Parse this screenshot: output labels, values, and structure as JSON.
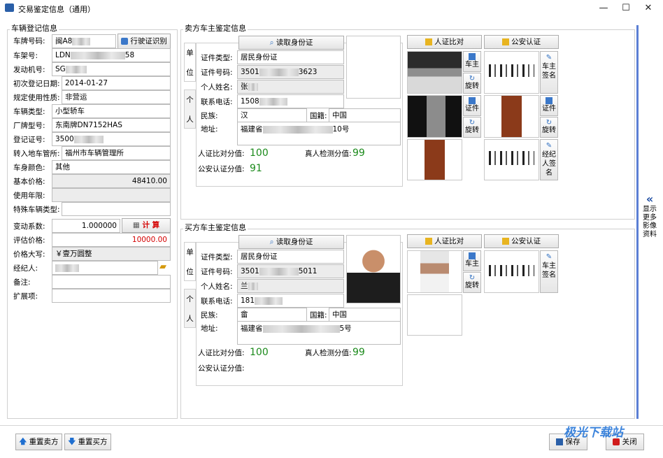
{
  "window": {
    "title": "交易鉴定信息（通用）",
    "minimize": "—",
    "maximize": "☐",
    "close": "✕"
  },
  "vehicle": {
    "section_title": "车辆登记信息",
    "plate_label": "车牌号码:",
    "plate_value": "闽A8",
    "ocr_button": "行驶证识别",
    "vin_label": "车架号:",
    "vin_value_start": "LDN",
    "vin_value_end": "58",
    "engine_label": "发动机号:",
    "engine_value": "SG",
    "first_reg_label": "初次登记日期:",
    "first_reg_value": "2014-01-27",
    "usage_label": "规定使用性质:",
    "usage_value": "非营运",
    "type_label": "车辆类型:",
    "type_value": "小型轿车",
    "model_label": "厂牌型号:",
    "model_value": "东南牌DN7152HAS",
    "cert_label": "登记证号:",
    "cert_value": "3500",
    "transfer_label": "转入地车管所:",
    "transfer_value": "福州市车辆管理所",
    "color_label": "车身颜色:",
    "color_value": "其他",
    "base_price_label": "基本价格:",
    "base_price_value": "48410.00",
    "years_label": "使用年限:",
    "years_value": "",
    "special_label": "特殊车辆类型:",
    "special_value": "",
    "coef_label": "变动系数:",
    "coef_value": "1.000000",
    "calc_button": "计 算",
    "eval_label": "评估价格:",
    "eval_value": "10000.00",
    "upper_label": "价格大写:",
    "upper_value": "￥壹万圆整",
    "broker_label": "经纪人:",
    "broker_value": "",
    "note_label": "备注:",
    "note_value": "",
    "ext_label": "扩展项:",
    "ext_value": ""
  },
  "seller": {
    "section_title": "卖方车主鉴定信息",
    "tab_chars": [
      "单",
      "位",
      "个",
      "人"
    ],
    "read_id_button": "读取身份证",
    "id_type_label": "证件类型:",
    "id_type_value": "居民身份证",
    "id_no_label": "证件号码:",
    "id_no_start": "3501",
    "id_no_end": "3623",
    "name_label": "个人姓名:",
    "name_value": "张",
    "phone_label": "联系电话:",
    "phone_value": "1508",
    "nation_label": "民族:",
    "nation_value": "汉",
    "country_label": "国籍:",
    "country_value": "中国",
    "addr_label": "地址:",
    "addr_start": "福建省",
    "addr_end": "10号",
    "match_label": "人证比对分值:",
    "match_value": "100",
    "liveness_label": "真人检测分值:",
    "liveness_value": "99",
    "police_label": "公安认证分值:",
    "police_value": "91",
    "compare_button": "人证比对",
    "police_button": "公安认证",
    "side_owner": "车主",
    "side_rotate": "旋转",
    "side_owner_sign": "车主签名",
    "side_cert": "证件",
    "side_broker_sign": "经纪人签名"
  },
  "buyer": {
    "section_title": "买方车主鉴定信息",
    "tab_chars": [
      "单",
      "位",
      "个",
      "人"
    ],
    "read_id_button": "读取身份证",
    "id_type_label": "证件类型:",
    "id_type_value": "居民身份证",
    "id_no_label": "证件号码:",
    "id_no_start": "3501",
    "id_no_end": "5011",
    "name_label": "个人姓名:",
    "name_value": "兰",
    "phone_label": "联系电话:",
    "phone_value": "181",
    "nation_label": "民族:",
    "nation_value": "畲",
    "country_label": "国籍:",
    "country_value": "中国",
    "addr_label": "地址:",
    "addr_start": "福建省",
    "addr_end": "5号",
    "match_label": "人证比对分值:",
    "match_value": "100",
    "liveness_label": "真人检测分值:",
    "liveness_value": "99",
    "police_label": "公安认证分值:",
    "police_value": "",
    "compare_button": "人证比对",
    "police_button": "公安认证",
    "side_owner": "车主",
    "side_rotate": "旋转",
    "side_owner_sign": "车主签名"
  },
  "side_panel": {
    "arrow": "«",
    "label": "显示更多影像资料"
  },
  "footer": {
    "reset_seller": "重置卖方",
    "reset_buyer": "重置买方",
    "save": "保存",
    "close": "关闭"
  },
  "watermark": "极光下载站",
  "colors": {
    "accent": "#1f4ea3",
    "score": "#1b8a1b",
    "price_red": "#d40000",
    "side_bar": "#5b7fd4"
  }
}
